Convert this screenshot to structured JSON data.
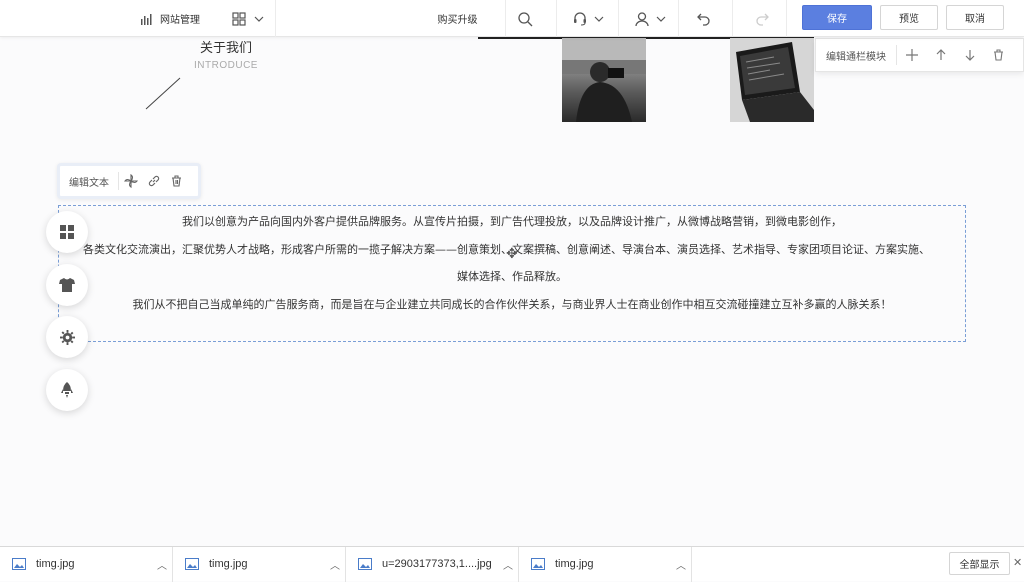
{
  "toolbar": {
    "site_manage": "网站管理",
    "upgrade": "购买升级",
    "save": "保存",
    "preview": "预览",
    "cancel": "取消"
  },
  "about": {
    "title": "关于我们",
    "subtitle": "INTRODUCE"
  },
  "module_toolbar": {
    "label": "编辑通栏模块"
  },
  "text_toolbar": {
    "label": "编辑文本"
  },
  "text_block": {
    "p1": "我们以创意为产品向国内外客户提供品牌服务。从宣传片拍摄，到广告代理投放，以及品牌设计推广，从微博战略营销，到微电影创作，",
    "p2": "各类文化交流演出，汇聚优势人才战略，形成客户所需的一揽子解决方案——创意策划、文案撰稿、创意阐述、导演台本、演员选择、艺术指导、专家团项目论证、方案实施、",
    "p3": "媒体选择、作品释放。",
    "p4": "我们从不把自己当成单纯的广告服务商，而是旨在与企业建立共同成长的合作伙伴关系，与商业界人士在商业创作中相互交流碰撞建立互补多赢的人脉关系！"
  },
  "downloads": {
    "items": [
      {
        "name": "timg.jpg"
      },
      {
        "name": "timg.jpg"
      },
      {
        "name": "u=2903177373,1....jpg"
      },
      {
        "name": "timg.jpg"
      }
    ],
    "show_all": "全部显示"
  }
}
